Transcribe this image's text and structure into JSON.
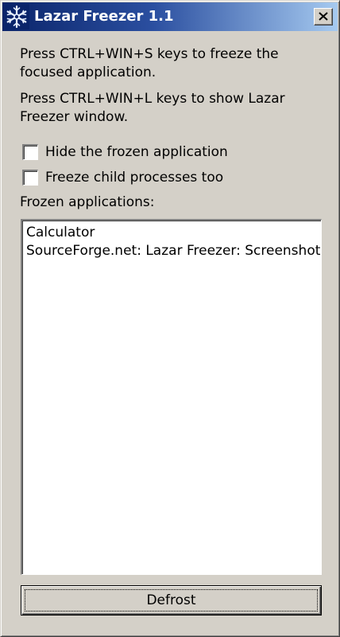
{
  "window": {
    "title": "Lazar Freezer 1.1",
    "icon": "snowflake-icon",
    "close_icon": "close-icon"
  },
  "instructions": {
    "freeze_text": "Press CTRL+WIN+S keys to freeze the\nfocused application.",
    "show_text": "Press CTRL+WIN+L keys to show Lazar\nFreezer window."
  },
  "options": {
    "hide_frozen_label": "Hide the frozen application",
    "hide_frozen_checked": false,
    "freeze_children_label": "Freeze child processes too",
    "freeze_children_checked": false
  },
  "frozen_list": {
    "caption": "Frozen applications:",
    "items": [
      "Calculator",
      "SourceForge.net: Lazar Freezer: Screenshots"
    ]
  },
  "buttons": {
    "defrost_label": "Defrost"
  },
  "colors": {
    "titlebar_start": "#0a246a",
    "titlebar_end": "#a6caf0",
    "face": "#d4d0c8"
  }
}
